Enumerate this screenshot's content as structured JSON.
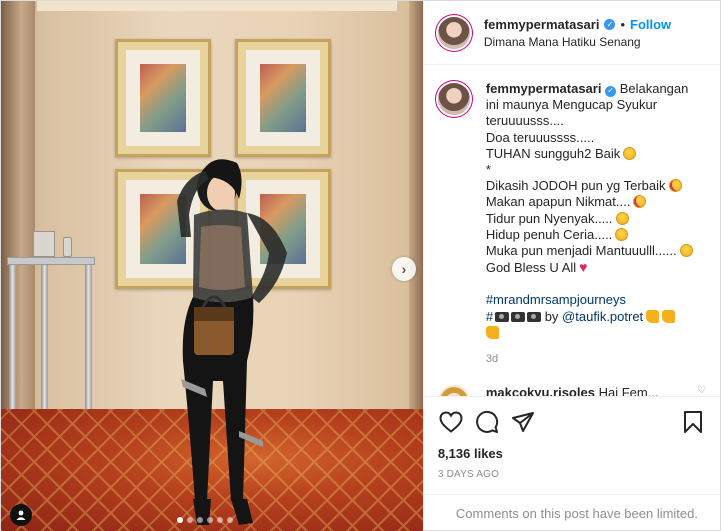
{
  "post": {
    "username": "femmypermatasari",
    "follow_label": "Follow",
    "separator": "•",
    "location": "Dimana Mana Hatiku Senang",
    "verified_icon": "verified-badge-icon"
  },
  "caption": {
    "username": "femmypermatasari",
    "lines": [
      "Belakangan",
      "ini maunya Mengucap Syukur",
      "teruuuusss....",
      "Doa teruuussss.....",
      "TUHAN sungguh2 Baik",
      "*",
      "Dikasih JODOH pun yg Terbaik",
      "Makan apapun Nikmat....",
      "Tidur pun Nyenyak.....",
      "Hidup penuh Ceria.....",
      "Muka pun menjadi Mantuuulll......",
      "God Bless U All"
    ],
    "hashtag": "#mrandmrsampjourneys",
    "hashtag2": "#",
    "by_label": "by",
    "mention": "@taufik.potret",
    "time": "3d"
  },
  "comment": {
    "username": "makcokyu.risoles",
    "text": "Hai Fem..."
  },
  "stats": {
    "likes": "8,136 likes",
    "posted": "3 DAYS AGO"
  },
  "footer": {
    "limited_text": "Comments on this post have been limited."
  },
  "carousel": {
    "slide_count": 6,
    "active_index": 0
  },
  "colors": {
    "follow": "#0095f6",
    "hashtag": "#00376b",
    "muted": "#8e8e8e",
    "text": "#262626"
  }
}
